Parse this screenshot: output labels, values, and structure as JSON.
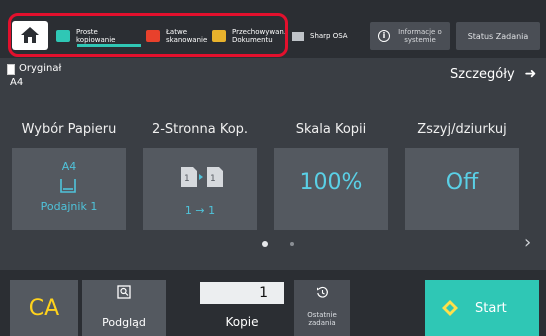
{
  "topbar": {
    "shortcuts": [
      {
        "label": "Proste\nkopiowanie",
        "icon": "copy-icon",
        "color": "#2fc7b5"
      },
      {
        "label": "Łatwe\nskanowanie",
        "icon": "scan-icon",
        "color": "#e8412c"
      },
      {
        "label": "Przechowywan.\nDokumentu",
        "icon": "folder-icon",
        "color": "#e8b22c"
      }
    ],
    "sharp_osa": "Sharp OSA",
    "info": "Informacje o\nsystemie",
    "status": "Status Zadania"
  },
  "original": {
    "label": "Oryginał",
    "size": "A4"
  },
  "details": "Szczegóły",
  "functions": {
    "paper": {
      "title": "Wybór Papieru",
      "size": "A4",
      "tray": "Podajnik 1"
    },
    "duplex": {
      "title": "2-Stronna Kop.",
      "mode": "1 → 1"
    },
    "scale": {
      "title": "Skala Kopii",
      "value": "100%"
    },
    "staple": {
      "title": "Zszyj/dziurkuj",
      "value": "Off"
    }
  },
  "pager": {
    "pages": 2,
    "current": 1
  },
  "bottom": {
    "ca": "CA",
    "preview": "Podgląd",
    "copies_value": "1",
    "copies_label": "Kopie",
    "recent": "Ostatnie\nzadania",
    "start": "Start"
  },
  "colors": {
    "accent": "#2fc7b5",
    "highlight": "#e3102d",
    "ca": "#ffd21c",
    "value": "#5ad0e6"
  }
}
